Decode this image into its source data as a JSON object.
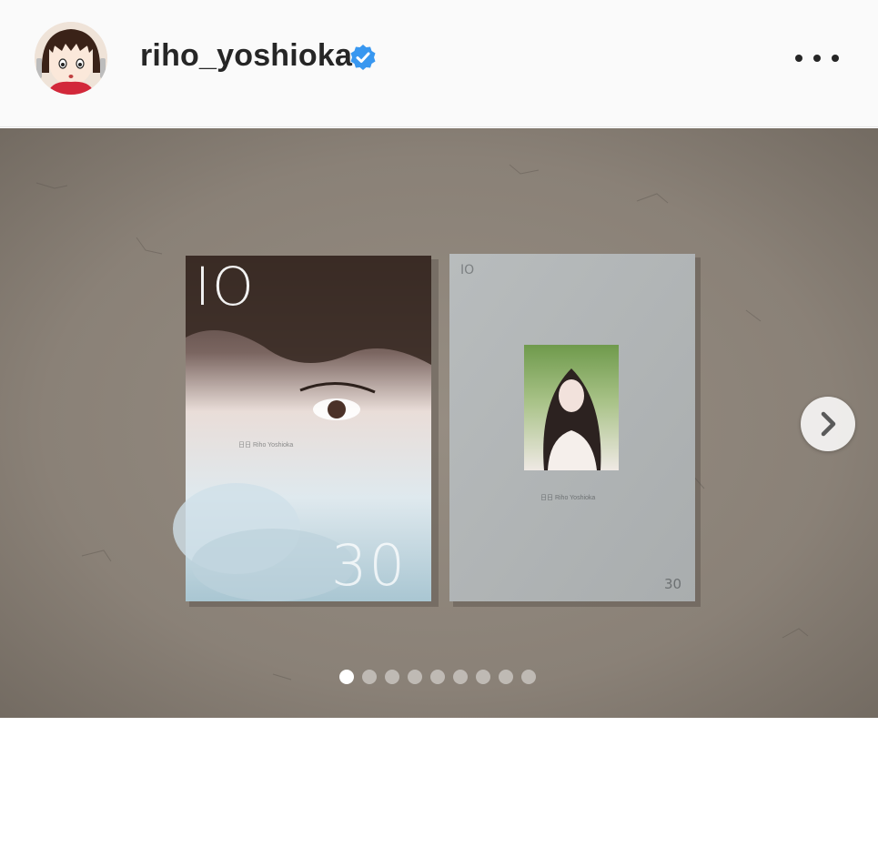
{
  "header": {
    "username": "riho_yoshioka",
    "verified_icon": "verified-badge-icon",
    "more_icon": "more-options-icon"
  },
  "post": {
    "book_left": {
      "cover_number_top": "IO",
      "cover_number_bottom": "30",
      "cover_author": "日日 Riho Yoshioka"
    },
    "book_right": {
      "cover_number_top": "IO",
      "cover_number_bottom": "30",
      "cover_author": "日日 Riho Yoshioka"
    }
  },
  "carousel": {
    "next_icon": "chevron-right-icon",
    "total_slides": 9,
    "active_index": 0
  },
  "colors": {
    "header_bg": "#fafafa",
    "verified_blue": "#3897f0",
    "text": "#262626"
  }
}
